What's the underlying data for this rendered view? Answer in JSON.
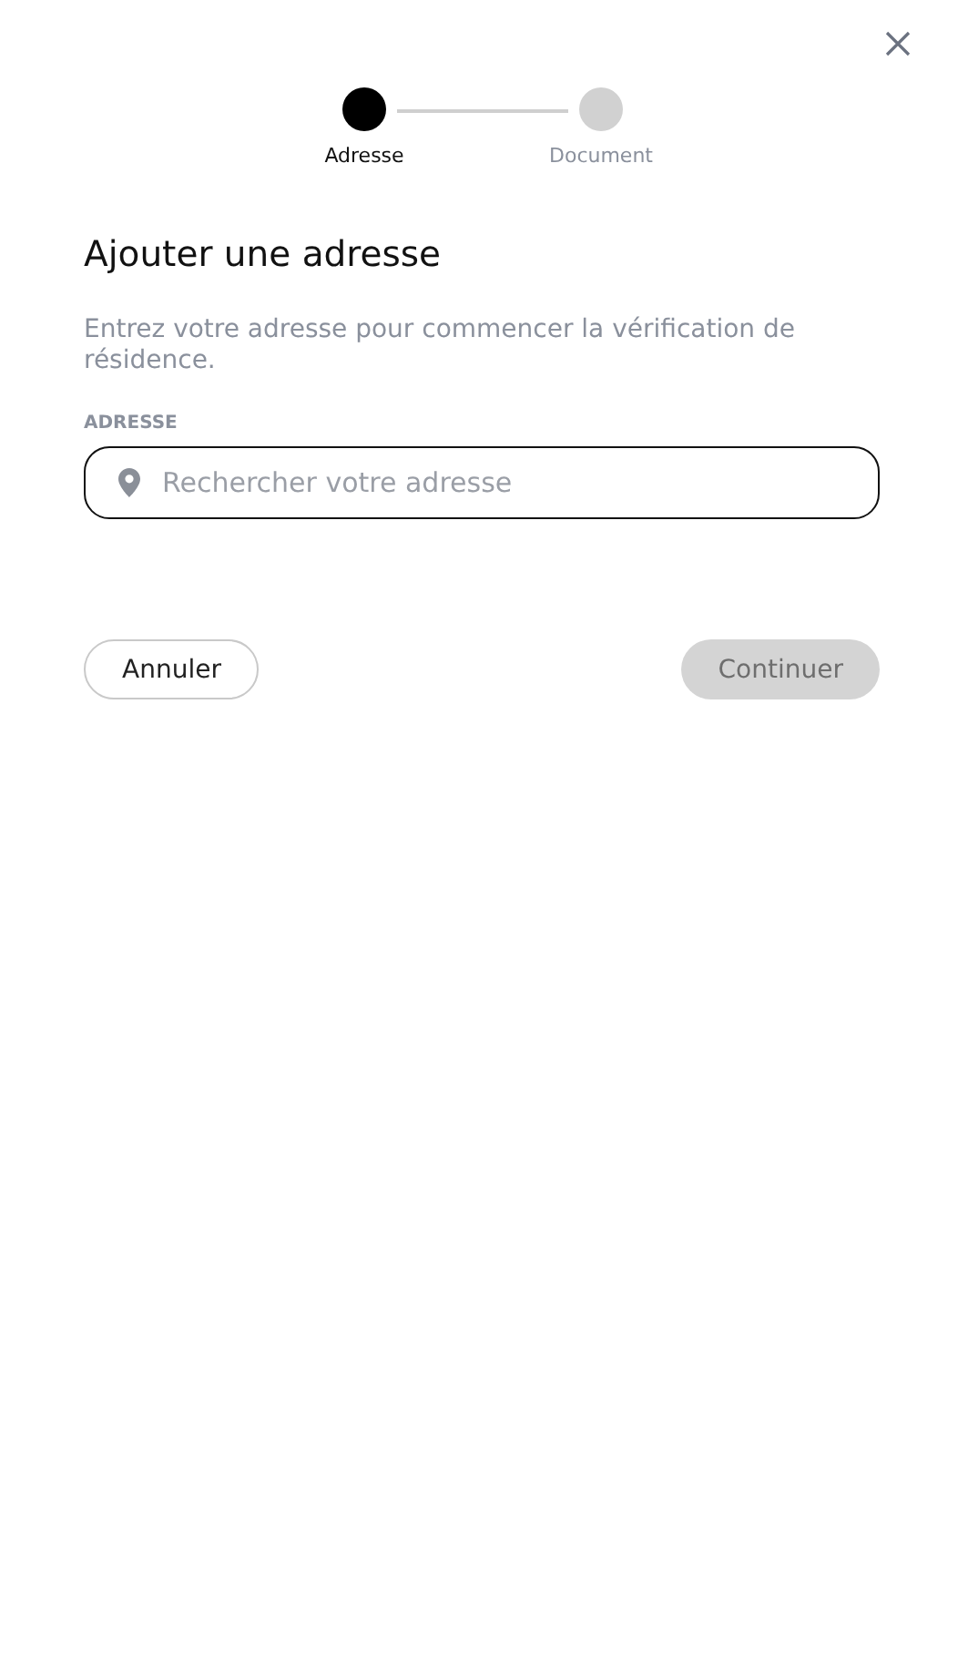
{
  "steps": [
    {
      "label": "Adresse",
      "selected": true
    },
    {
      "label": "Document",
      "selected": false
    }
  ],
  "title": "Ajouter une adresse",
  "description": "Entrez votre adresse pour commencer la vérification de résidence.",
  "address": {
    "label": "ADRESSE",
    "placeholder": "Rechercher votre adresse"
  },
  "buttons": [
    {
      "label": "Annuler",
      "kind": "secondary",
      "disabled": false
    },
    {
      "label": "Continuer",
      "kind": "primary",
      "disabled": true
    }
  ]
}
